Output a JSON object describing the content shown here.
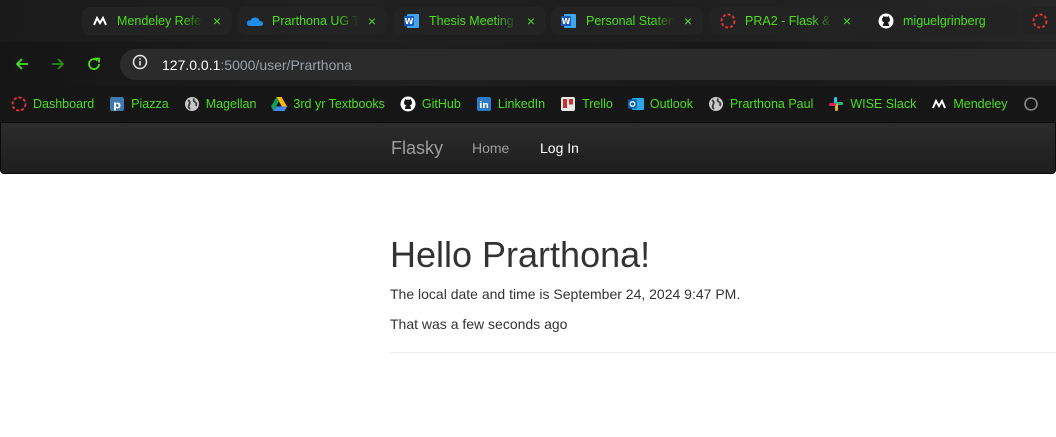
{
  "browser": {
    "tabs": [
      {
        "title": "Mendeley Refe",
        "icon": "mendeley-icon"
      },
      {
        "title": "Prarthona UG T",
        "icon": "onedrive-icon"
      },
      {
        "title": "Thesis Meeting",
        "icon": "word-icon"
      },
      {
        "title": "Personal Staten",
        "icon": "word-icon"
      },
      {
        "title": "PRA2 - Flask &",
        "icon": "dashed-circle-icon"
      },
      {
        "title": "miguelgrinberg",
        "icon": "github-icon"
      }
    ],
    "tab_close_glyph": "×",
    "address": {
      "host": "127.0.0.1",
      "rest": ":5000/user/Prarthona"
    },
    "bookmarks": [
      {
        "label": "Dashboard",
        "icon": "dashed-circle-icon"
      },
      {
        "label": "Piazza",
        "icon": "piazza-icon"
      },
      {
        "label": "Magellan",
        "icon": "globe-icon"
      },
      {
        "label": "3rd yr Textbooks",
        "icon": "google-drive-icon"
      },
      {
        "label": "GitHub",
        "icon": "github-icon"
      },
      {
        "label": "LinkedIn",
        "icon": "linkedin-icon"
      },
      {
        "label": "Trello",
        "icon": "trello-icon"
      },
      {
        "label": "Outlook",
        "icon": "outlook-icon"
      },
      {
        "label": "Prarthona Paul",
        "icon": "globe-icon"
      },
      {
        "label": "WISE Slack",
        "icon": "slack-icon"
      },
      {
        "label": "Mendeley",
        "icon": "mendeley-icon"
      }
    ],
    "colors": {
      "tab_text": "#4ade1a",
      "chrome_bg": "#1e1e1e"
    }
  },
  "navbar": {
    "brand": "Flasky",
    "links": [
      {
        "label": "Home"
      },
      {
        "label": "Log In"
      }
    ]
  },
  "page": {
    "heading": "Hello Prarthona!",
    "datetime_text": "The local date and time is September 24, 2024 9:47 PM.",
    "relative_text": "That was a few seconds ago"
  }
}
